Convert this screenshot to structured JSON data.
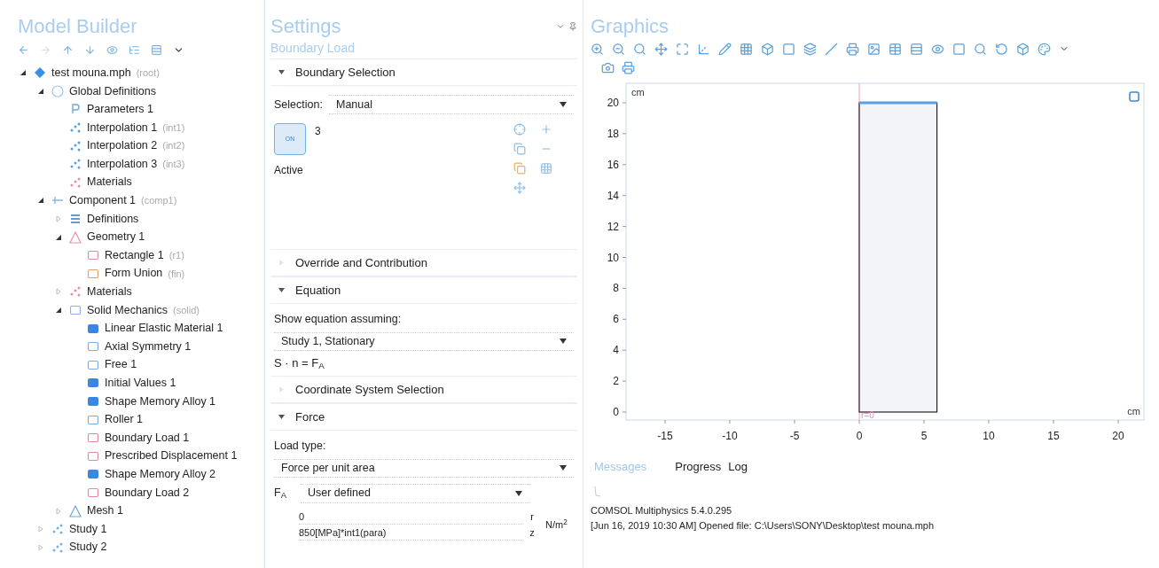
{
  "model_builder": {
    "title": "Model Builder",
    "tree": [
      {
        "label": "test mouna.mph",
        "tag": "(root)",
        "kind": "root",
        "expanded": true,
        "children": [
          {
            "label": "Global Definitions",
            "kind": "globe",
            "expanded": true,
            "children": [
              {
                "label": "Parameters 1",
                "kind": "param"
              },
              {
                "label": "Interpolation 1",
                "tag": "(int1)",
                "kind": "interp"
              },
              {
                "label": "Interpolation 2",
                "tag": "(int2)",
                "kind": "interp"
              },
              {
                "label": "Interpolation 3",
                "tag": "(int3)",
                "kind": "interp"
              },
              {
                "label": "Materials",
                "kind": "material"
              }
            ]
          },
          {
            "label": "Component 1",
            "tag": "(comp1)",
            "kind": "component",
            "expanded": true,
            "children": [
              {
                "label": "Definitions",
                "kind": "list",
                "expanded": false
              },
              {
                "label": "Geometry 1",
                "kind": "geometry",
                "expanded": true,
                "children": [
                  {
                    "label": "Rectangle 1",
                    "tag": "(r1)",
                    "kind": "rect"
                  },
                  {
                    "label": "Form Union",
                    "tag": "(fin)",
                    "kind": "union"
                  }
                ]
              },
              {
                "label": "Materials",
                "kind": "material",
                "expanded": false
              },
              {
                "label": "Solid Mechanics",
                "tag": "(solid)",
                "kind": "physics",
                "expanded": true,
                "children": [
                  {
                    "label": "Linear Elastic Material 1",
                    "kind": "domain"
                  },
                  {
                    "label": "Axial Symmetry 1",
                    "kind": "boundary"
                  },
                  {
                    "label": "Free 1",
                    "kind": "boundary"
                  },
                  {
                    "label": "Initial Values 1",
                    "kind": "domain"
                  },
                  {
                    "label": "Shape Memory Alloy 1",
                    "kind": "domain"
                  },
                  {
                    "label": "Roller 1",
                    "kind": "boundary"
                  },
                  {
                    "label": "Boundary Load 1",
                    "kind": "load"
                  },
                  {
                    "label": "Prescribed Displacement 1",
                    "kind": "load"
                  },
                  {
                    "label": "Shape Memory Alloy 2",
                    "kind": "domain"
                  },
                  {
                    "label": "Boundary Load 2",
                    "kind": "load"
                  }
                ]
              },
              {
                "label": "Mesh 1",
                "kind": "mesh",
                "expanded": false
              }
            ]
          },
          {
            "label": "Study 1",
            "kind": "study",
            "expanded": false
          },
          {
            "label": "Study 2",
            "kind": "study",
            "expanded": false
          }
        ]
      }
    ]
  },
  "settings": {
    "title": "Settings",
    "subtitle": "Boundary Load",
    "sections": [
      {
        "kind": "selection",
        "title": "Boundary Selection",
        "expanded": true,
        "selection_label": "Selection:",
        "selection_value": "Manual",
        "items": [
          "3"
        ],
        "active": {
          "text": "ON",
          "label": "Active",
          "on": true
        }
      },
      {
        "title": "Override and Contribution",
        "expanded": false
      },
      {
        "kind": "equation",
        "title": "Equation",
        "expanded": true,
        "assume_label": "Show equation assuming:",
        "assume_value": "Study 1, Stationary",
        "equation": "S · n = F$_{A}$"
      },
      {
        "title": "Coordinate System Selection",
        "expanded": false
      },
      {
        "kind": "force",
        "title": "Force",
        "expanded": true,
        "load_label": "Load type:",
        "load_value": "Force per unit area",
        "symbol": "F$_{A}$",
        "mode": "User defined",
        "vector": [
          {
            "value": "0",
            "component": "r"
          },
          {
            "value": "850[MPa]*int1(para)",
            "component": "z"
          }
        ],
        "unit": "N/m$^{2}$"
      }
    ]
  },
  "graphics": {
    "title": "Graphics",
    "y_unit": "cm",
    "x_unit": "cm",
    "axis_label": "r=0",
    "x_ticks": [
      "-15",
      "-10",
      "-5",
      "0",
      "5",
      "10",
      "15",
      "20"
    ],
    "y_ticks": [
      "20",
      "18",
      "16",
      "14",
      "12",
      "10",
      "8",
      "6",
      "4",
      "2",
      "0"
    ]
  },
  "messages": {
    "tabs": [
      {
        "label": "Messages",
        "selected": true
      },
      {
        "label": "Progress",
        "selected": false
      },
      {
        "label": "Log",
        "selected": false
      }
    ],
    "lines": [
      "COMSOL Multiphysics 5.4.0.295",
      "[Jun 16, 2019 10:30 AM] Opened file: C:\\Users\\SONY\\Desktop\\test mouna.mph"
    ]
  }
}
